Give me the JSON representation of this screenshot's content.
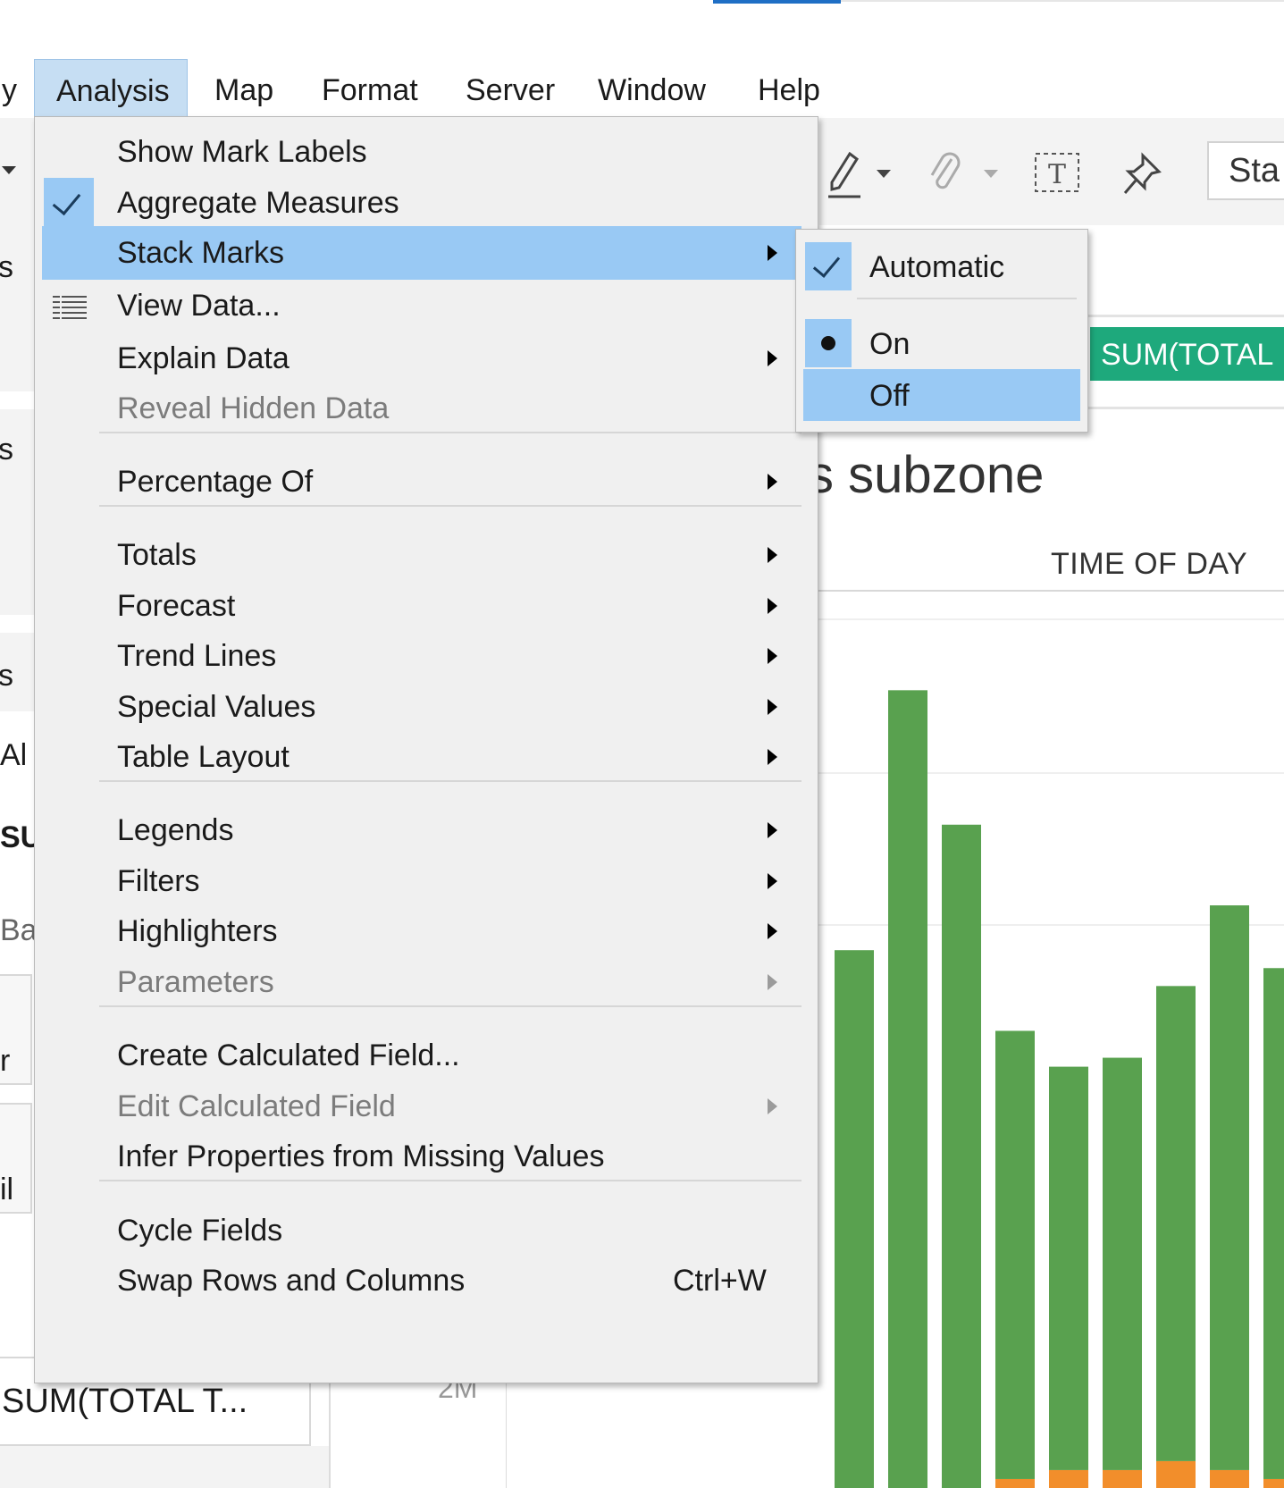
{
  "menubar": {
    "items": [
      {
        "label": "y"
      },
      {
        "label": "Analysis"
      },
      {
        "label": "Map"
      },
      {
        "label": "Format"
      },
      {
        "label": "Server"
      },
      {
        "label": "Window"
      },
      {
        "label": "Help"
      }
    ]
  },
  "toolbar": {
    "start_box": "Sta"
  },
  "left_fragments": {
    "f1": "s",
    "f2": "s",
    "f3": "s",
    "f4": "Al",
    "f5": "SU",
    "f6": "Ba",
    "f7": "r",
    "f8": "il",
    "sum_pill": "SUM(TOTAL T..."
  },
  "view": {
    "rows_pill": "SUM(TOTAL",
    "title": "s subzone",
    "column_header": "TIME OF DAY",
    "axis_tick": "2M"
  },
  "analysis_menu": {
    "items": [
      {
        "label": "Show Mark Labels"
      },
      {
        "label": "Aggregate Measures",
        "checked": true
      },
      {
        "label": "Stack Marks",
        "submenu": true
      },
      {
        "label": "View Data...",
        "icon": "table-grid-icon"
      },
      {
        "label": "Explain Data",
        "submenu": true
      },
      {
        "label": "Reveal Hidden Data",
        "disabled": true
      },
      {
        "label": "Percentage Of",
        "submenu": true
      },
      {
        "label": "Totals",
        "submenu": true
      },
      {
        "label": "Forecast",
        "submenu": true
      },
      {
        "label": "Trend Lines",
        "submenu": true
      },
      {
        "label": "Special Values",
        "submenu": true
      },
      {
        "label": "Table Layout",
        "submenu": true
      },
      {
        "label": "Legends",
        "submenu": true
      },
      {
        "label": "Filters",
        "submenu": true
      },
      {
        "label": "Highlighters",
        "submenu": true
      },
      {
        "label": "Parameters",
        "submenu": true,
        "disabled": true
      },
      {
        "label": "Create Calculated Field..."
      },
      {
        "label": "Edit Calculated Field",
        "submenu": true,
        "disabled": true
      },
      {
        "label": "Infer Properties from Missing Values"
      },
      {
        "label": "Cycle Fields"
      },
      {
        "label": "Swap Rows and Columns",
        "shortcut": "Ctrl+W"
      }
    ]
  },
  "stack_marks_submenu": {
    "items": [
      {
        "label": "Automatic",
        "state": "checked"
      },
      {
        "label": "On",
        "state": "selected"
      },
      {
        "label": "Off",
        "state": "highlighted"
      }
    ]
  },
  "colors": {
    "bar_green": "#59a14f",
    "bar_orange": "#f28e2b",
    "pill_green": "#1ea97c",
    "highlight": "#99c9f4",
    "active_menu": "#c6def3"
  },
  "chart_data": {
    "type": "bar",
    "stacked": true,
    "note_values_relative": true,
    "series": [
      {
        "values": [
          0,
          0,
          0,
          0.01,
          0.02,
          0.02,
          0.03,
          0.02,
          0.01
        ]
      },
      {
        "values": [
          0.6,
          0.89,
          0.74,
          0.5,
          0.45,
          0.46,
          0.53,
          0.63,
          0.57
        ]
      }
    ]
  }
}
